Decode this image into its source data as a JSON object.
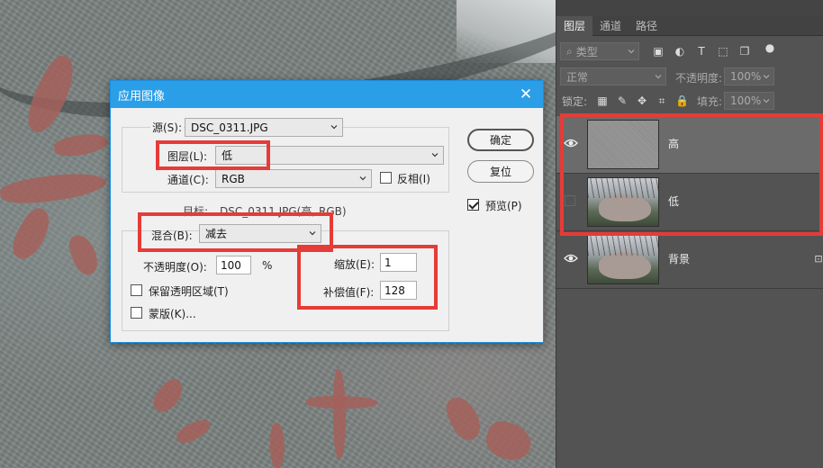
{
  "dialog": {
    "title": "应用图像",
    "source_label": "源(S):",
    "source_value": "DSC_0311.JPG",
    "layer_label": "图层(L):",
    "layer_value": "低",
    "channel_label": "通道(C):",
    "channel_value": "RGB",
    "invert_label": "反相(I)",
    "target_label": "目标:",
    "target_value": "DSC_0311.JPG(高, RGB)",
    "blend_label": "混合(B):",
    "blend_value": "减去",
    "opacity_label": "不透明度(O):",
    "opacity_value": "100",
    "opacity_unit": "%",
    "scale_label": "缩放(E):",
    "scale_value": "1",
    "offset_label": "补偿值(F):",
    "offset_value": "128",
    "preserve_label": "保留透明区域(T)",
    "mask_label": "蒙版(K)...",
    "ok_label": "确定",
    "reset_label": "复位",
    "preview_label": "预览(P)",
    "preview_checked": true,
    "invert_checked": false,
    "preserve_checked": false,
    "mask_checked": false
  },
  "panel": {
    "tabs": [
      "图层",
      "通道",
      "路径"
    ],
    "filter_label": "类型",
    "blend_mode": "正常",
    "opacity_label": "不透明度:",
    "opacity_value": "100%",
    "lock_label": "锁定:",
    "fill_label": "填充:",
    "fill_value": "100%",
    "layers": [
      {
        "name": "高",
        "visible": true,
        "selected": true
      },
      {
        "name": "低",
        "visible": false,
        "selected": false
      },
      {
        "name": "背景",
        "visible": true,
        "selected": false,
        "locked": true
      }
    ]
  },
  "colors": {
    "titlebar": "#2b9ee8",
    "highlight_red": "#e63b37",
    "panel_bg": "#535353"
  }
}
